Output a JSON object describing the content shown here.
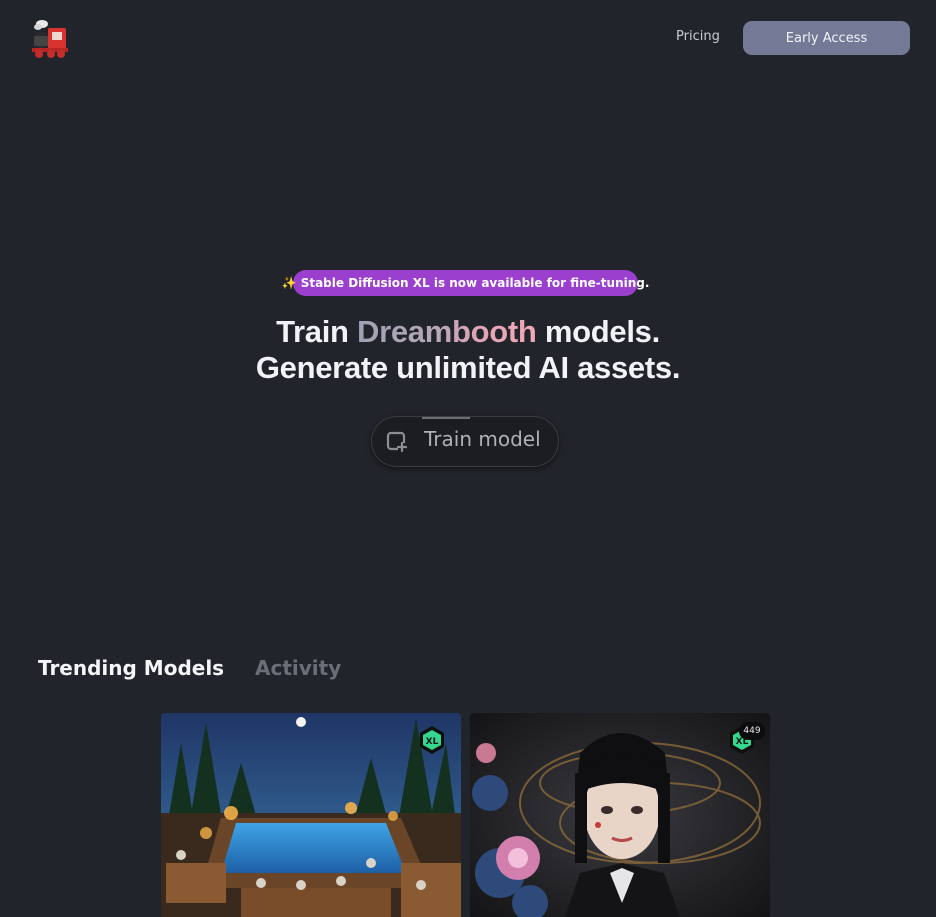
{
  "header": {
    "pricing_label": "Pricing",
    "early_access_label": "Early Access"
  },
  "hero": {
    "announcement": "✨ Stable Diffusion XL is now available for fine-tuning.",
    "title_line1_pre": "Train ",
    "title_line1_highlight": "Dreambooth",
    "title_line1_post": " models.",
    "title_line2": "Generate unlimited AI assets.",
    "train_button_label": "Train model"
  },
  "tabs": {
    "trending": "Trending Models",
    "activity": "Activity"
  },
  "cards": [
    {
      "badge": "XL"
    },
    {
      "badge": "XL",
      "count": "449"
    }
  ],
  "colors": {
    "background": "#22242b",
    "accent_button": "#747a96",
    "announcement": "#9b3fcf",
    "xl_badge": "#35d68f"
  }
}
